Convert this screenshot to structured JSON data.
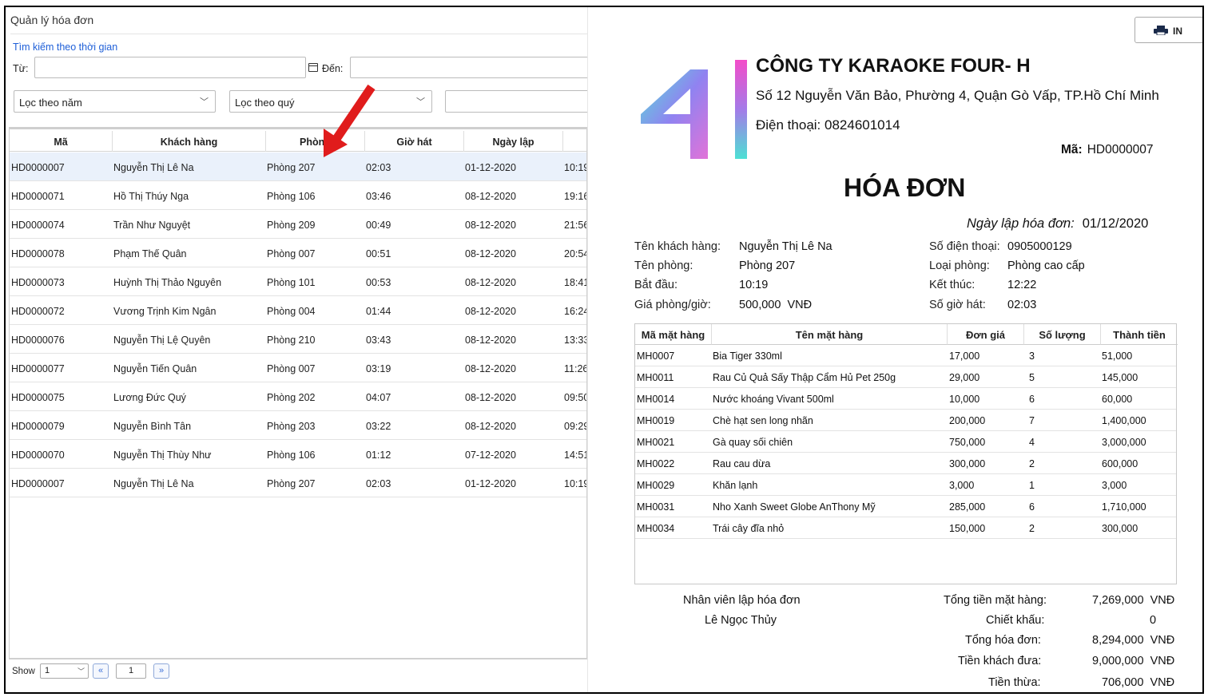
{
  "left": {
    "panel_title": "Quản lý hóa đơn",
    "search_title": "Tìm kiếm theo thời gian",
    "from_label": "Từ:",
    "to_label": "Đến:",
    "filter_year": "Lọc theo năm",
    "filter_quarter": "Lọc theo quý",
    "columns": [
      "Mã",
      "Khách hàng",
      "Phòng",
      "Giờ hát",
      "Ngày lập"
    ],
    "rows": [
      {
        "ma": "HD0000007",
        "khach": "Nguyễn Thị Lê Na",
        "phong": "Phòng 207",
        "gio": "02:03",
        "ngay": "01-12-2020",
        "bd": "10:19"
      },
      {
        "ma": "HD0000071",
        "khach": "Hồ Thị Thúy Nga",
        "phong": "Phòng 106",
        "gio": "03:46",
        "ngay": "08-12-2020",
        "bd": "19:16"
      },
      {
        "ma": "HD0000074",
        "khach": "Trần Như Nguyệt",
        "phong": "Phòng 209",
        "gio": "00:49",
        "ngay": "08-12-2020",
        "bd": "21:56"
      },
      {
        "ma": "HD0000078",
        "khach": "Phạm Thế Quân",
        "phong": "Phòng 007",
        "gio": "00:51",
        "ngay": "08-12-2020",
        "bd": "20:54"
      },
      {
        "ma": "HD0000073",
        "khach": "Huỳnh Thị Thảo Nguyên",
        "phong": "Phòng 101",
        "gio": "00:53",
        "ngay": "08-12-2020",
        "bd": "18:41"
      },
      {
        "ma": "HD0000072",
        "khach": "Vương Trịnh Kim Ngân",
        "phong": "Phòng 004",
        "gio": "01:44",
        "ngay": "08-12-2020",
        "bd": "16:24"
      },
      {
        "ma": "HD0000076",
        "khach": "Nguyễn Thị Lệ Quyên",
        "phong": "Phòng 210",
        "gio": "03:43",
        "ngay": "08-12-2020",
        "bd": "13:33"
      },
      {
        "ma": "HD0000077",
        "khach": "Nguyễn Tiến Quân",
        "phong": "Phòng 007",
        "gio": "03:19",
        "ngay": "08-12-2020",
        "bd": "11:26"
      },
      {
        "ma": "HD0000075",
        "khach": "Lương Đức Quý",
        "phong": "Phòng 202",
        "gio": "04:07",
        "ngay": "08-12-2020",
        "bd": "09:50"
      },
      {
        "ma": "HD0000079",
        "khach": "Nguyễn Bình Tân",
        "phong": "Phòng 203",
        "gio": "03:22",
        "ngay": "08-12-2020",
        "bd": "09:29"
      },
      {
        "ma": "HD0000070",
        "khach": "Nguyễn Thị Thùy Như",
        "phong": "Phòng 106",
        "gio": "01:12",
        "ngay": "07-12-2020",
        "bd": "14:51"
      },
      {
        "ma": "HD0000007",
        "khach": "Nguyễn Thị Lê Na",
        "phong": "Phòng 207",
        "gio": "02:03",
        "ngay": "01-12-2020",
        "bd": "10:19"
      }
    ],
    "pager": {
      "show_label": "Show",
      "page_size": "1",
      "page": "1"
    }
  },
  "right": {
    "print_label": "IN",
    "company_name": "CÔNG TY KARAOKE FOUR- H",
    "address": "Số 12 Nguyễn Văn Bảo, Phường 4, Quận Gò Vấp, TP.Hồ Chí Minh",
    "phone": "Điện thoại: 0824601014",
    "ma_label": "Mã:",
    "ma_value": "HD0000007",
    "title": "HÓA ĐƠN",
    "date_label": "Ngày lập hóa đơn:",
    "date_value": "01/12/2020",
    "info": {
      "customer_label": "Tên khách hàng:",
      "customer": "Nguyễn Thị Lê Na",
      "room_label": "Tên phòng:",
      "room": "Phòng 207",
      "start_label": "Bắt đầu:",
      "start": "10:19",
      "price_label": "Giá phòng/giờ:",
      "price": "500,000  VNĐ",
      "phone_label": "Số điện thoại:",
      "phone": "0905000129",
      "type_label": "Loại phòng:",
      "type": "Phòng cao cấp",
      "end_label": "Kết thúc:",
      "end": "12:22",
      "hours_label": "Số giờ hát:",
      "hours": "02:03"
    },
    "item_columns": [
      "Mã mặt hàng",
      "Tên mặt hàng",
      "Đơn giá",
      "Số lượng",
      "Thành tiền"
    ],
    "items": [
      {
        "ma": "MH0007",
        "ten": "Bia Tiger 330ml",
        "gia": "17,000",
        "sl": "3",
        "tt": "51,000"
      },
      {
        "ma": "MH0011",
        "ten": "Rau Củ Quả Sấy Thập Cẩm Hủ Pet 250g",
        "gia": "29,000",
        "sl": "5",
        "tt": "145,000"
      },
      {
        "ma": "MH0014",
        "ten": "Nước khoáng Vivant 500ml",
        "gia": "10,000",
        "sl": "6",
        "tt": "60,000"
      },
      {
        "ma": "MH0019",
        "ten": "Chè hạt sen long nhãn",
        "gia": "200,000",
        "sl": "7",
        "tt": "1,400,000"
      },
      {
        "ma": "MH0021",
        "ten": "Gà quay sối chiên",
        "gia": "750,000",
        "sl": "4",
        "tt": "3,000,000"
      },
      {
        "ma": "MH0022",
        "ten": "Rau cau dừa",
        "gia": "300,000",
        "sl": "2",
        "tt": "600,000"
      },
      {
        "ma": "MH0029",
        "ten": "Khăn lạnh",
        "gia": "3,000",
        "sl": "1",
        "tt": "3,000"
      },
      {
        "ma": "MH0031",
        "ten": "Nho Xanh Sweet Globe AnThony Mỹ",
        "gia": "285,000",
        "sl": "6",
        "tt": "1,710,000"
      },
      {
        "ma": "MH0034",
        "ten": "Trái cây đĩa nhỏ",
        "gia": "150,000",
        "sl": "2",
        "tt": "300,000"
      }
    ],
    "staff_label": "Nhân viên lập hóa đơn",
    "staff_name": "Lê Ngọc Thủy",
    "totals": {
      "items_label": "Tổng tiền mặt hàng:",
      "items": "7,269,000  VNĐ",
      "discount_label": "Chiết khấu:",
      "discount": "0",
      "total_label": "Tổng hóa đơn:",
      "total": "8,294,000  VNĐ",
      "paid_label": "Tiền khách đưa:",
      "paid": "9,000,000  VNĐ",
      "change_label": "Tiền thừa:",
      "change": "706,000  VNĐ"
    }
  }
}
